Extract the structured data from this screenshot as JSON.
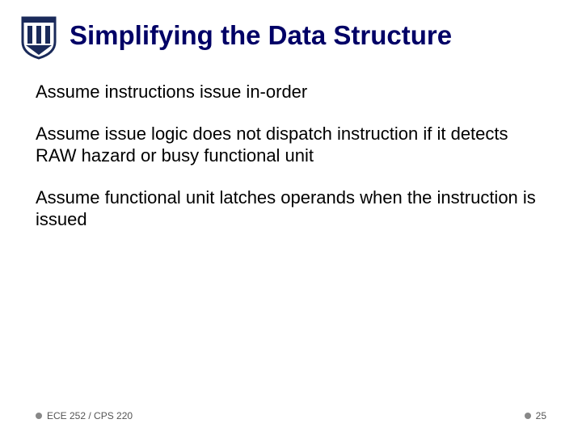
{
  "slide": {
    "title": "Simplifying the Data Structure",
    "paragraphs": [
      "Assume instructions issue in-order",
      "Assume issue logic does not dispatch instruction if  it detects RAW hazard or busy functional unit",
      "Assume functional unit latches operands when the instruction is issued"
    ],
    "footer_left": "ECE 252 / CPS 220",
    "footer_right": "25",
    "logo_name": "duke-shield-logo"
  }
}
